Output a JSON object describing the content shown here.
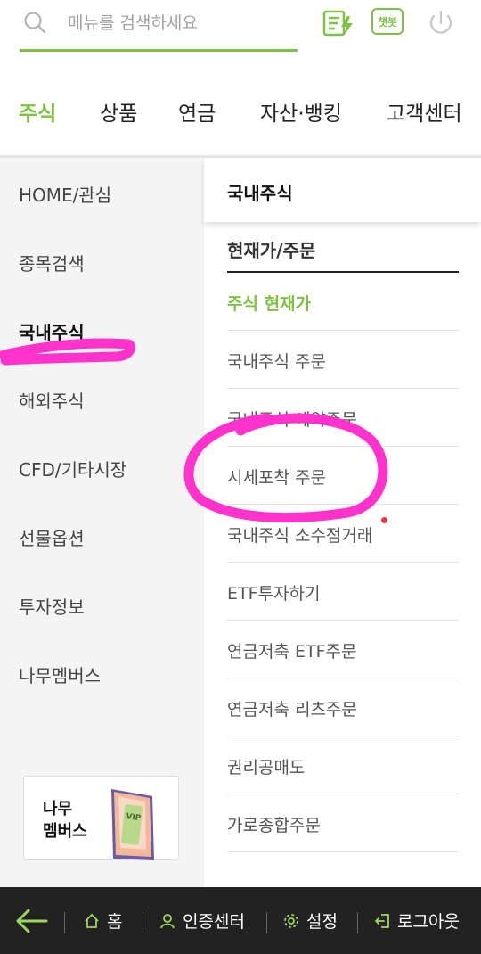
{
  "search": {
    "placeholder": "메뉴를 검색하세요"
  },
  "header_icons": {
    "chatbot_label": "챗봇"
  },
  "main_tabs": [
    {
      "label": "주식",
      "active": true
    },
    {
      "label": "상품"
    },
    {
      "label": "연금"
    },
    {
      "label": "자산·뱅킹"
    },
    {
      "label": "고객센터"
    }
  ],
  "left_nav": [
    {
      "label": "HOME/관심"
    },
    {
      "label": "종목검색"
    },
    {
      "label": "국내주식",
      "active": true
    },
    {
      "label": "해외주식"
    },
    {
      "label": "CFD/기타시장"
    },
    {
      "label": "선물옵션"
    },
    {
      "label": "투자정보"
    },
    {
      "label": "나무멤버스"
    }
  ],
  "right_panel": {
    "header": "국내주식",
    "section_title": "현재가/주문",
    "items": [
      {
        "label": "주식 현재가",
        "active": true
      },
      {
        "label": "국내주식 주문"
      },
      {
        "label": "국내주식 예약주문"
      },
      {
        "label": "시세포착 주문"
      },
      {
        "label": "국내주식 소수점거래",
        "new": true
      },
      {
        "label": "ETF투자하기"
      },
      {
        "label": "연금저축 ETF주문"
      },
      {
        "label": "연금저축 리츠주문"
      },
      {
        "label": "권리공매도"
      },
      {
        "label": "가로종합주문"
      }
    ]
  },
  "namu_card": {
    "label": "나무\n멤버스",
    "badge": "VIP"
  },
  "bottom_bar": {
    "home": "홈",
    "auth": "인증센터",
    "settings": "설정",
    "logout": "로그아웃"
  },
  "colors": {
    "accent": "#7dc242",
    "highlight": "#ff33cc",
    "bottom_bar": "#222222",
    "new_dot": "#e8384f"
  }
}
